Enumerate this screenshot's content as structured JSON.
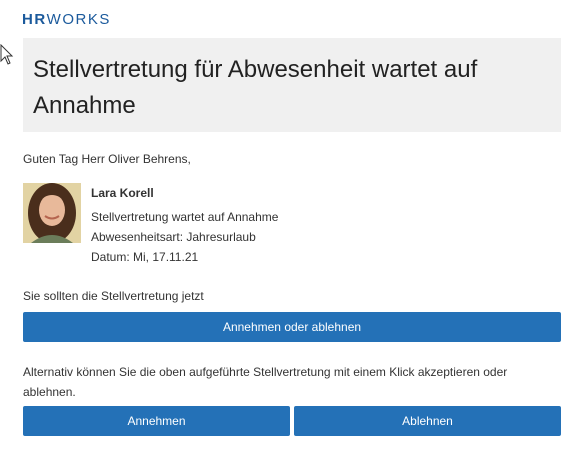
{
  "logo": {
    "hr": "HR",
    "works": "WORKS"
  },
  "header": {
    "title": "Stellvertretung für Abwesenheit wartet auf Annahme"
  },
  "greeting": "Guten Tag Herr Oliver Behrens,",
  "request": {
    "name": "Lara Korell",
    "status": "Stellvertretung wartet auf Annahme",
    "absence_type": "Abwesenheitsart: Jahresurlaub",
    "date": "Datum: Mi, 17.11.21"
  },
  "intro": "Sie sollten die Stellvertretung jetzt",
  "buttons": {
    "accept_or_decline": "Annehmen oder ablehnen",
    "accept": "Annehmen",
    "decline": "Ablehnen"
  },
  "alternative_text": "Alternativ können Sie die oben aufgeführte Stellvertretung mit einem Klick akzeptieren oder ablehnen.",
  "colors": {
    "brand": "#1b5a9c",
    "button": "#2471b7",
    "header_bg": "#f0f0f0"
  },
  "icons": {
    "cursor": "mouse-pointer-icon"
  }
}
